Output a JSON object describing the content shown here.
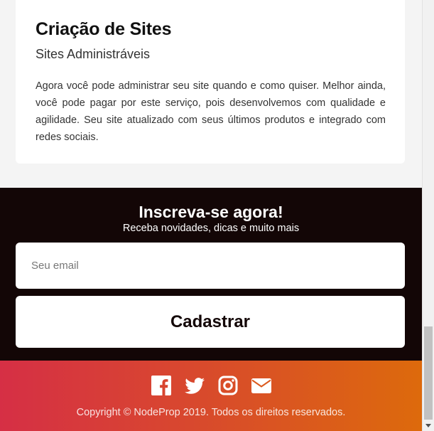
{
  "service_card": {
    "title": "Criação de Sites",
    "subtitle": "Sites Administráveis",
    "description": "Agora você pode administrar seu site quando e como quiser. Melhor ainda, você pode pagar por este serviço, pois desenvolvemos com qualidade e agilidade. Seu site atualizado com seus últimos produtos e integrado com redes sociais."
  },
  "newsletter": {
    "title": "Inscreva-se agora!",
    "subtitle": "Receba novidades, dicas e muito mais",
    "email_placeholder": "Seu email",
    "email_value": "",
    "submit_label": "Cadastrar"
  },
  "footer": {
    "social": [
      "facebook-icon",
      "twitter-icon",
      "instagram-icon",
      "envelope-icon"
    ],
    "copyright": "Copyright © NodeProp 2019. Todos os direitos reservados."
  },
  "colors": {
    "newsletter_bg": "#130606",
    "footer_gradient_start": "#d62f45",
    "footer_gradient_end": "#dd6a0c",
    "page_bg": "#f4f4f4"
  }
}
